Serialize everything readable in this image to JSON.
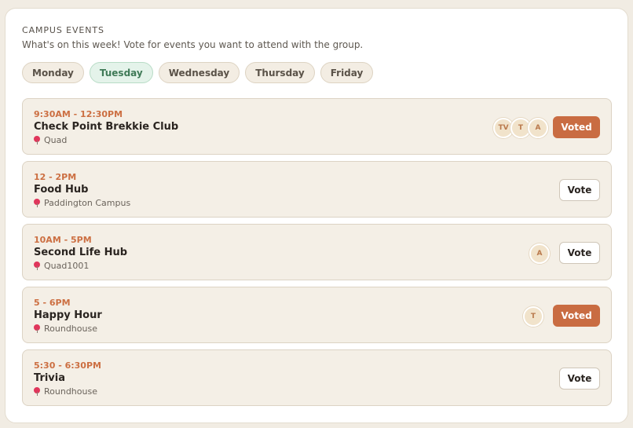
{
  "header": {
    "title": "CAMPUS EVENTS",
    "subtitle": "What's on this week! Vote for events you want to attend with the group."
  },
  "days": [
    {
      "label": "Monday",
      "active": false
    },
    {
      "label": "Tuesday",
      "active": true
    },
    {
      "label": "Wednesday",
      "active": false
    },
    {
      "label": "Thursday",
      "active": false
    },
    {
      "label": "Friday",
      "active": false
    }
  ],
  "events": [
    {
      "time": "9:30AM - 12:30PM",
      "name": "Check Point Brekkie Club",
      "location": "Quad",
      "attendees": [
        "TV",
        "T",
        "A"
      ],
      "button": "Voted",
      "voted": true
    },
    {
      "time": "12 - 2PM",
      "name": "Food Hub",
      "location": "Paddington Campus",
      "attendees": [],
      "button": "Vote",
      "voted": false
    },
    {
      "time": "10AM - 5PM",
      "name": "Second Life Hub",
      "location": "Quad1001",
      "attendees": [
        "A"
      ],
      "button": "Vote",
      "voted": false
    },
    {
      "time": "5 - 6PM",
      "name": "Happy Hour",
      "location": "Roundhouse",
      "attendees": [
        "T"
      ],
      "button": "Voted",
      "voted": true
    },
    {
      "time": "5:30 - 6:30PM",
      "name": "Trivia",
      "location": "Roundhouse",
      "attendees": [],
      "button": "Vote",
      "voted": false
    }
  ],
  "icons": {
    "location": "map-pin-icon"
  },
  "colors": {
    "accent": "#c96c42",
    "active_day_bg": "#e4f3ea",
    "active_day_text": "#3f7a57",
    "time_text": "#cc6f42"
  }
}
